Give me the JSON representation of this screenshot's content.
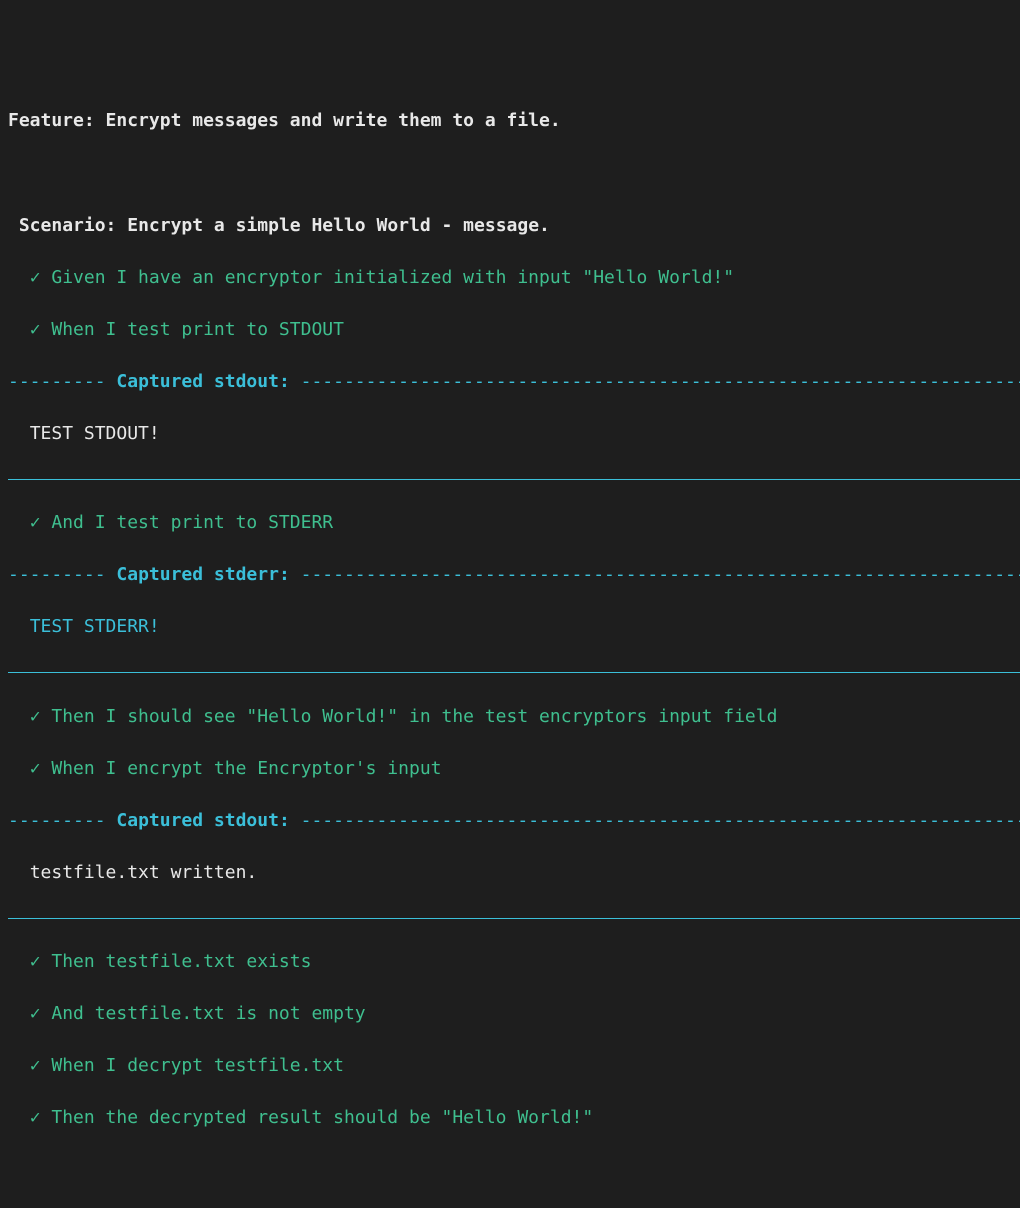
{
  "feature": {
    "label": "Feature:",
    "text": "Encrypt messages and write them to a file."
  },
  "scenario": {
    "label": "Scenario:",
    "text": "Encrypt a simple Hello World - message."
  },
  "checkmark": "✓",
  "steps": {
    "s1": "Given I have an encryptor initialized with input \"Hello World!\"",
    "s2": "When I test print to STDOUT",
    "s3": "And I test print to STDERR",
    "s4": "Then I should see \"Hello World!\" in the test encryptors input field",
    "s5": "When I encrypt the Encryptor's input",
    "s6": "Then testfile.txt exists",
    "s7": "And testfile.txt is not empty",
    "s8": "When I decrypt testfile.txt",
    "s9": "Then the decrypted result should be \"Hello World!\""
  },
  "capture": {
    "lead_dash": "---------",
    "trail_dash": "-----------------------------------------------------------------------",
    "stdout_label": "Captured stdout:",
    "stderr_label": "Captured stderr:",
    "out1": "TEST STDOUT!",
    "out2": "TEST STDERR!",
    "out3": "testfile.txt written."
  }
}
